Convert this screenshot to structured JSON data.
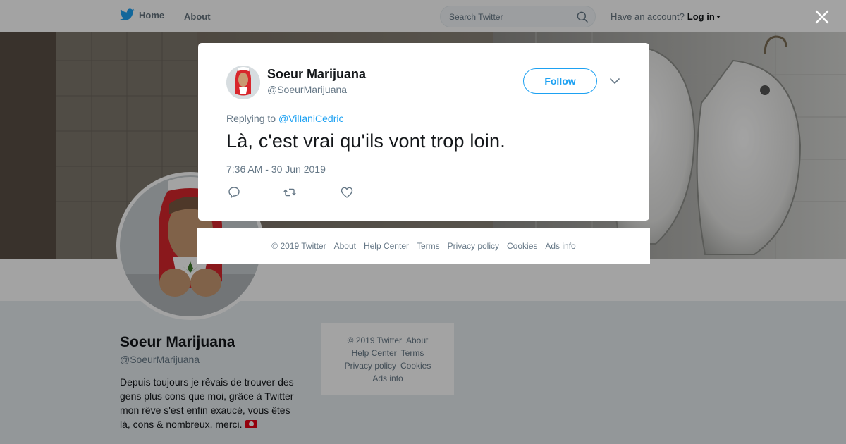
{
  "nav": {
    "home_label": "Home",
    "about_label": "About",
    "search_placeholder": "Search Twitter",
    "have_account": "Have an account?",
    "login_label": "Log in"
  },
  "profile": {
    "name": "Soeur Marijuana",
    "handle": "@SoeurMarijuana",
    "bio": "Depuis toujours je rêvais de trouver des gens plus cons que moi, grâce à Twitter mon rêve s'est enfin exaucé, vous êtes là, cons & nombreux, merci."
  },
  "side_footer": {
    "copyright": "© 2019 Twitter",
    "about": "About",
    "help": "Help Center",
    "terms": "Terms",
    "privacy": "Privacy policy",
    "cookies": "Cookies",
    "ads": "Ads info"
  },
  "tweet": {
    "author_name": "Soeur Marijuana",
    "author_handle": "@SoeurMarijuana",
    "follow_label": "Follow",
    "replying_prefix": "Replying to",
    "replying_to": "@VilIaniCedric",
    "text": "Là, c'est vrai qu'ils vont trop loin.",
    "timestamp": "7:36 AM - 30 Jun 2019"
  },
  "modal_footer": {
    "copyright": "© 2019 Twitter",
    "about": "About",
    "help": "Help Center",
    "terms": "Terms",
    "privacy": "Privacy policy",
    "cookies": "Cookies",
    "ads": "Ads info"
  },
  "icons": {
    "brand": "twitter-bird-icon",
    "search": "search-icon",
    "close": "close-icon",
    "chevron": "chevron-down-icon",
    "reply": "reply-icon",
    "retweet": "retweet-icon",
    "like": "heart-icon",
    "flag": "tunisia-flag-icon"
  },
  "colors": {
    "brand_blue": "#1da1f2",
    "text": "#14171a",
    "secondary_text": "#657786",
    "page_bg": "#e6ecf0"
  }
}
